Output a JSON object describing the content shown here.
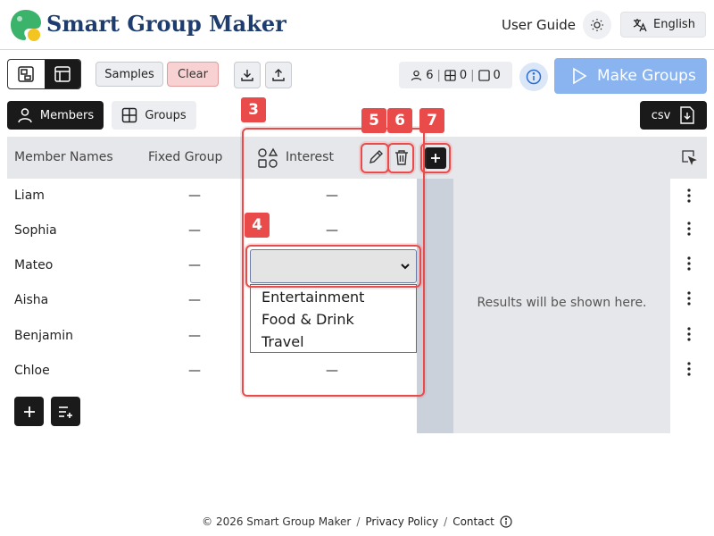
{
  "app": {
    "title": "Smart Group Maker"
  },
  "header": {
    "user_guide": "User Guide",
    "language": "English",
    "theme_icon": "sun-icon",
    "translate_icon": "translate-icon"
  },
  "toolbar": {
    "samples_label": "Samples",
    "clear_label": "Clear",
    "stats": {
      "members": "6",
      "groups": "0",
      "fixed": "0"
    },
    "make_groups_label": "Make Groups"
  },
  "tabs": [
    {
      "label": "Members",
      "active": true
    },
    {
      "label": "Groups",
      "active": false
    }
  ],
  "csv_label": "csv",
  "table": {
    "headers": {
      "names": "Member Names",
      "fixed": "Fixed Group",
      "interest": "Interest"
    },
    "rows": [
      {
        "name": "Liam",
        "fixed": "—",
        "interest": "—"
      },
      {
        "name": "Sophia",
        "fixed": "—",
        "interest": "—"
      },
      {
        "name": "Mateo",
        "fixed": "—",
        "interest": ""
      },
      {
        "name": "Aisha",
        "fixed": "—",
        "interest": ""
      },
      {
        "name": "Benjamin",
        "fixed": "—",
        "interest": ""
      },
      {
        "name": "Chloe",
        "fixed": "—",
        "interest": "—"
      }
    ]
  },
  "interest_options": [
    "Entertainment",
    "Food & Drink",
    "Travel"
  ],
  "results_placeholder": "Results will be shown here.",
  "annotations": [
    "3",
    "4",
    "5",
    "6",
    "7"
  ],
  "footer": {
    "copyright": "© 2026 Smart Group Maker",
    "privacy": "Privacy Policy",
    "contact": "Contact"
  },
  "colors": {
    "brand_title": "#1e3d6e",
    "accent_blue": "#8ab4f0",
    "highlight_red": "#e94a4a",
    "clear_bg": "#f8d2d2"
  }
}
